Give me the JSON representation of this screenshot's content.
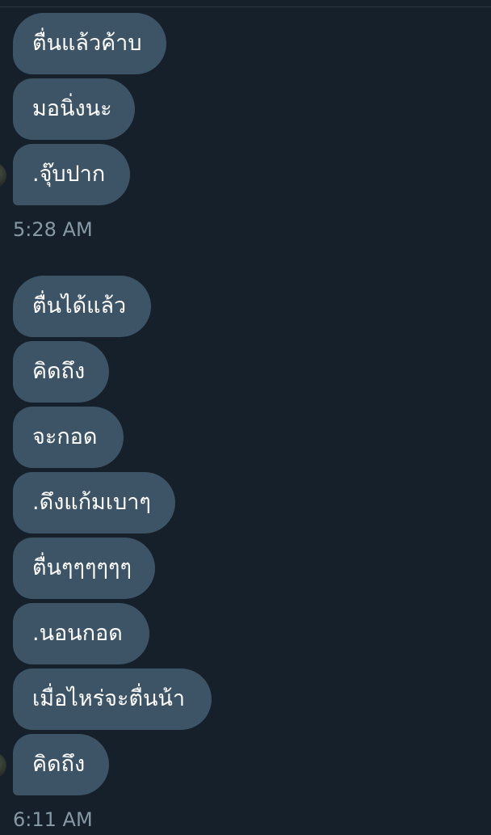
{
  "colors": {
    "background": "#15202b",
    "bubble": "#3d5466",
    "text": "#ffffff",
    "timestamp": "#8899a6"
  },
  "groups": [
    {
      "messages": [
        "ตื่นแล้วค้าบ",
        "มอนิ่งนะ",
        ".จุ๊บปาก"
      ],
      "time": "5:28 AM"
    },
    {
      "messages": [
        "ตื่นได้แล้ว",
        "คิดถึง",
        "จะกอด",
        ".ดึงแก้มเบาๆ",
        "ตื่นๆๆๆๆๆๆ",
        ".นอนกอด",
        "เมื่อไหร่จะตื่นน้า",
        "คิดถึง"
      ],
      "time": "6:11 AM"
    }
  ],
  "avatar_icon": "user-avatar"
}
